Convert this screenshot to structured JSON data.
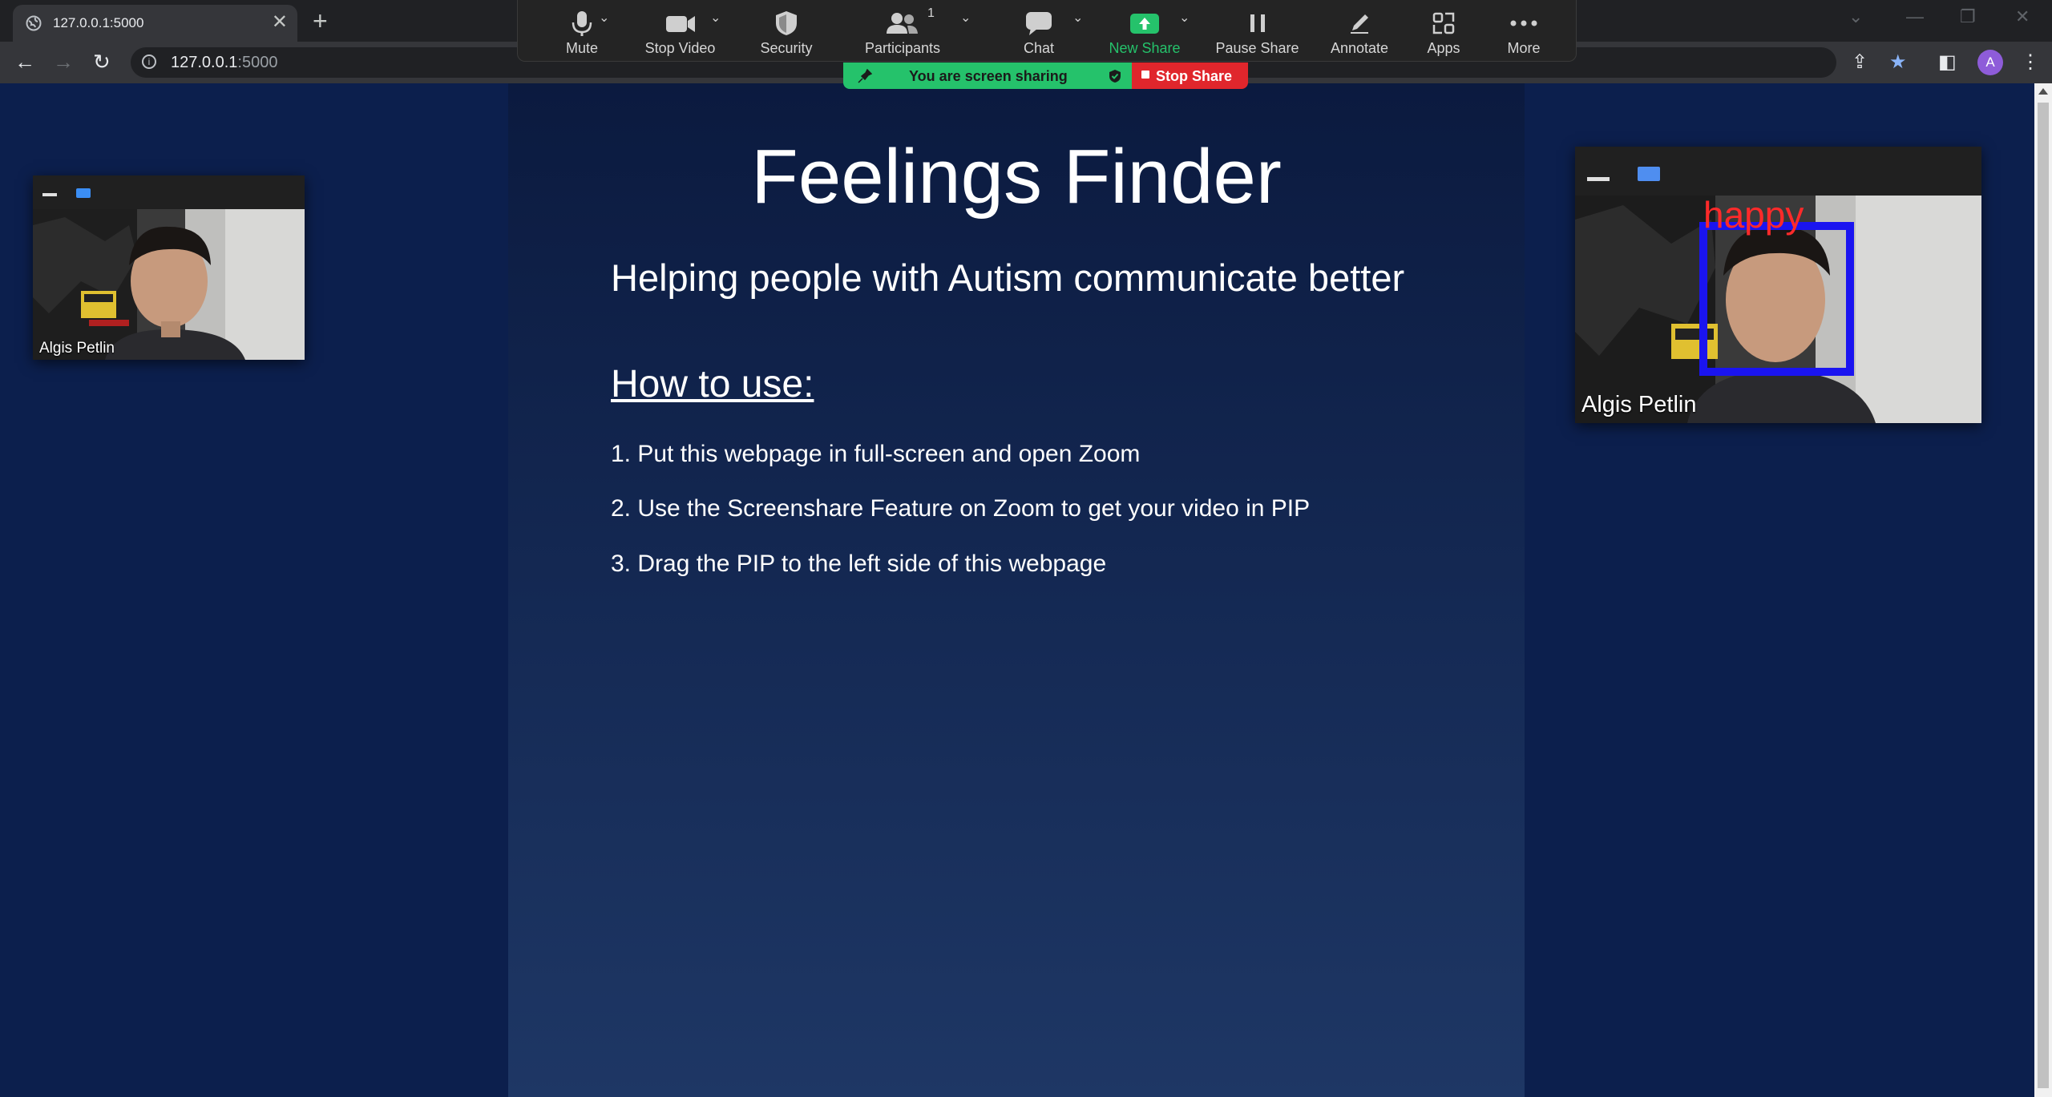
{
  "browser": {
    "tab_title": "127.0.0.1:5000",
    "url_host": "127.0.0.1",
    "url_port": ":5000",
    "profile_initial": "A"
  },
  "zoom": {
    "buttons": {
      "mute": "Mute",
      "stop_video": "Stop Video",
      "security": "Security",
      "participants": "Participants",
      "participants_count": "1",
      "chat": "Chat",
      "new_share": "New Share",
      "pause_share": "Pause Share",
      "annotate": "Annotate",
      "apps": "Apps",
      "more": "More"
    },
    "sharing_banner": "You are screen sharing",
    "stop_share": "Stop Share",
    "colors": {
      "green": "#25c26b",
      "red": "#e0262c"
    }
  },
  "page": {
    "title": "Feelings Finder",
    "subtitle": "Helping people with Autism communicate better",
    "howto_heading": "How to use:",
    "steps": [
      "1. Put this webpage in full-screen and open Zoom",
      "2. Use the Screenshare Feature on Zoom to get your video in PIP",
      "3. Drag the PIP to the left side of this webpage"
    ]
  },
  "pip_left": {
    "name": "Algis Petlin"
  },
  "pip_right": {
    "name": "Algis Petlin",
    "emotion_label": "happy"
  }
}
